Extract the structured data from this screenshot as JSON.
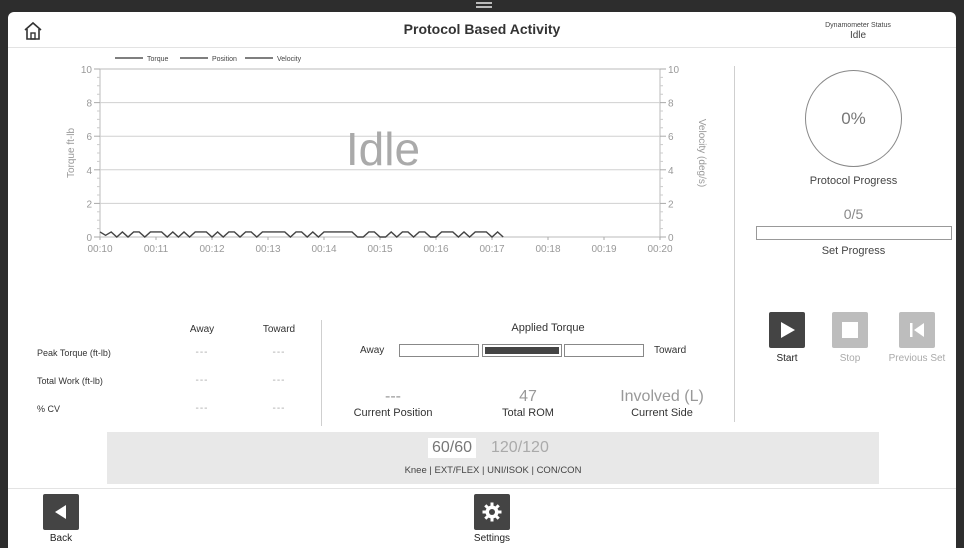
{
  "header": {
    "title": "Protocol Based Activity",
    "dynamometer_status_label": "Dynamometer Status",
    "dynamometer_status_value": "Idle"
  },
  "chart_data": {
    "type": "line",
    "legend": [
      "Torque",
      "Position",
      "Velocity"
    ],
    "legend_placement": "top-left",
    "ylabel_left": "Torque ft-lb",
    "ylabel_right": "Velocity (deg/s)",
    "ylim": [
      0,
      10
    ],
    "yticks": [
      0,
      2,
      4,
      6,
      8,
      10
    ],
    "xticks": [
      "00:10",
      "00:11",
      "00:12",
      "00:13",
      "00:14",
      "00:15",
      "00:16",
      "00:17",
      "00:18",
      "00:19",
      "00:20"
    ],
    "overlay_text": "Idle",
    "grid": true,
    "series": [
      {
        "name": "Torque",
        "x": [
          10.0,
          10.1,
          10.2,
          10.3,
          10.4,
          10.5,
          10.6,
          10.7,
          10.8,
          10.9,
          11.0,
          11.1,
          11.2,
          11.3,
          11.4,
          11.5,
          11.6,
          11.7,
          11.8,
          11.9,
          12.0,
          12.1,
          12.2,
          12.3,
          12.4,
          12.5,
          12.6,
          12.7,
          12.8,
          12.9,
          13.0,
          13.1,
          13.2,
          13.3,
          13.4,
          13.5,
          13.6,
          13.7,
          13.8,
          13.9,
          14.0,
          14.1,
          14.2,
          14.3,
          14.4,
          14.5,
          14.6,
          14.7,
          14.8,
          14.9,
          15.0,
          15.1,
          15.2,
          15.3,
          15.4,
          15.5,
          15.6,
          15.7,
          15.8,
          15.9,
          16.0,
          16.1,
          16.2,
          16.3,
          16.4,
          16.5,
          16.6,
          16.7,
          16.8,
          16.9,
          17.0,
          17.1,
          17.2
        ],
        "values": [
          0.3,
          0.1,
          0.3,
          0.0,
          0.3,
          0.0,
          0.3,
          0.3,
          0.0,
          0.3,
          0.3,
          0.3,
          0.0,
          0.3,
          0.0,
          0.3,
          0.0,
          0.3,
          0.3,
          0.3,
          0.0,
          0.3,
          0.0,
          0.3,
          0.3,
          0.0,
          0.3,
          0.3,
          0.0,
          0.3,
          0.3,
          0.3,
          0.3,
          0.3,
          0.0,
          0.3,
          0.3,
          0.0,
          0.3,
          0.0,
          0.3,
          0.3,
          0.3,
          0.3,
          0.3,
          0.3,
          0.0,
          0.0,
          0.3,
          0.3,
          0.0,
          0.0,
          0.3,
          0.0,
          0.3,
          0.3,
          0.0,
          0.3,
          0.3,
          0.0,
          0.0,
          0.3,
          0.3,
          0.3,
          0.0,
          0.3,
          0.0,
          0.3,
          0.3,
          0.3,
          0.0,
          0.3,
          0.0
        ]
      }
    ]
  },
  "right_panel": {
    "protocol_progress_value": "0%",
    "protocol_progress_label": "Protocol Progress",
    "set_progress_value": "0/5",
    "set_progress_fraction": 0,
    "set_progress_label": "Set Progress"
  },
  "controls": {
    "start": "Start",
    "stop": "Stop",
    "previous_set": "Previous Set"
  },
  "stats": {
    "col_away": "Away",
    "col_toward": "Toward",
    "rows": [
      {
        "label": "Peak Torque (ft-lb)",
        "away": "---",
        "toward": "---"
      },
      {
        "label": "Total Work (ft-lb)",
        "away": "---",
        "toward": "---"
      },
      {
        "label": "% CV",
        "away": "---",
        "toward": "---"
      }
    ]
  },
  "applied_torque": {
    "title": "Applied Torque",
    "away_label": "Away",
    "toward_label": "Toward"
  },
  "readouts": {
    "current_position_value": "---",
    "current_position_label": "Current Position",
    "total_rom_value": "47",
    "total_rom_label": "Total ROM",
    "current_side_value": "Involved (L)",
    "current_side_label": "Current Side"
  },
  "protocol": {
    "speeds": [
      "60/60",
      "120/120"
    ],
    "description": "Knee | EXT/FLEX | UNI/ISOK | CON/CON"
  },
  "footer": {
    "back": "Back",
    "settings": "Settings"
  }
}
